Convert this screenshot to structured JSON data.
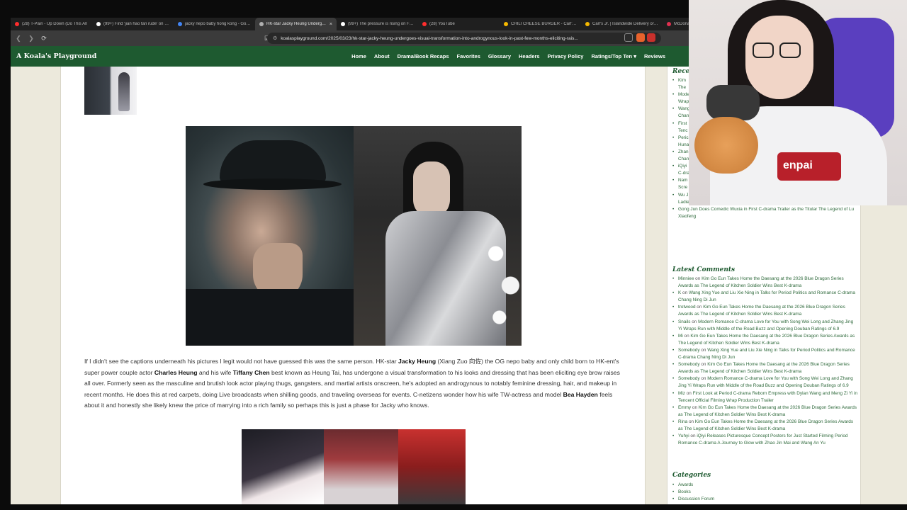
{
  "browser": {
    "tabs": [
      {
        "title": "(28) T-Pain - Up Down (Do This All",
        "color": "#ff2d2d"
      },
      {
        "title": "(99+) Find 'jian hao tan rude' on TikTok",
        "color": "#ffffff"
      },
      {
        "title": "jacky nepo baby hong kong - Google",
        "color": "#4285f4"
      },
      {
        "title": "HK-star Jacky Heung Undergoes",
        "color": "#b0b0b0",
        "active": true
      },
      {
        "title": "(99+) The pressure is rising on FIFA",
        "color": "#ffffff"
      },
      {
        "title": "(28) YouTube",
        "color": "#ff2d2d"
      },
      {
        "title": "CHILI CHEESE BURGER - Carl's Jr.",
        "color": "#f5b800"
      },
      {
        "title": "Carl's Jr. | Islandwide Delivery or Pick",
        "color": "#f5b800"
      },
      {
        "title": "McDona",
        "color": "#e03050"
      }
    ],
    "url": "koalasplayground.com/2025/03/23/hk-star-jacky-heung-undergoes-visual-transformation-into-androgynous-look-in-past-few-months-eliciting-rais..."
  },
  "site": {
    "brand": "A Koala's Playground",
    "nav": [
      "Home",
      "About",
      "Drama/Book Recaps",
      "Favorites",
      "Glossary",
      "Headers",
      "Privacy Policy",
      "Ratings/Top Ten ▾",
      "Reviews"
    ]
  },
  "article": {
    "p1": "If I didn't see the captions underneath his pictures I legit would not have guessed this was the same person. HK-star ",
    "name1": "Jacky Heung",
    "p2": " (Xiang Zuo 向佐) the OG nepo baby and only child born to HK-ent's super power couple actor ",
    "name2": "Charles Heung",
    "p3": " and his wife ",
    "name3": "Tiffany Chen",
    "p4": " best known as Heung Tai, has undergone a visual transformation to his looks and dressing that has been eliciting eye brow raises all over. Formerly seen as the masculine and brutish look actor playing thugs, gangsters, and martial artists onscreen, he's adopted an androgynous to notably feminine dressing, hair, and makeup in recent months. He does this at red carpets, doing Live broadcasts when shilling goods, and traveling overseas for events. C-netizens wonder how his wife TW-actress and model ",
    "name4": "Bea Hayden",
    "p5": " feels about it and honestly she likely knew the price of marrying into a rich family so perhaps this is just a phase for Jacky who knows."
  },
  "sidebar": {
    "recent_heading": "Recent",
    "recent_visible": [
      {
        "title": "Kim",
        "cont": "The"
      },
      {
        "title": "Mode",
        "cont": "Wrap"
      },
      {
        "title": "Wang",
        "cont": "Chan"
      },
      {
        "title": "First",
        "cont": "Tenc"
      },
      {
        "title": "Peric",
        "cont": "Huna"
      },
      {
        "title": "Zhan",
        "cont": "Chan"
      },
      {
        "title": "iQiyi",
        "cont": "C-dra"
      },
      {
        "title": "Nam",
        "cont": "Scre"
      },
      {
        "title": "Wu J",
        "cont": "Ladie"
      }
    ],
    "recent_last": "Gong Jun Does Comedic Wuxia in First C-drama Trailer as the Titular The Legend of Lu Xiaofeng",
    "comments_heading": "Latest Comments",
    "comments": [
      {
        "author": "Minniee",
        "post": "Kim Go Eun Takes Home the Daesang at the 2026 Blue Dragon Series Awards as The Legend of Kitchen Soldier Wins Best K-drama"
      },
      {
        "author": "K",
        "post": "Wang Xing Yue and Liu Xie Ning in Talks for Period Politics and Romance C-drama Chang Ning Di Jun"
      },
      {
        "author": "trotwood",
        "post": "Kim Go Eun Takes Home the Daesang at the 2026 Blue Dragon Series Awards as The Legend of Kitchen Soldier Wins Best K-drama"
      },
      {
        "author": "Snails",
        "post": "Modern Romance C-drama Love for You with Song Wei Long and Zhang Jing Yi Wraps Run with Middle of the Road Buzz and Opening Douban Ratings of 6.9"
      },
      {
        "author": "Mi",
        "post": "Kim Go Eun Takes Home the Daesang at the 2026 Blue Dragon Series Awards as The Legend of Kitchen Soldier Wins Best K-drama"
      },
      {
        "author": "Somebody",
        "post": "Wang Xing Yue and Liu Xie Ning in Talks for Period Politics and Romance C-drama Chang Ning Di Jun"
      },
      {
        "author": "Somebody",
        "post": "Kim Go Eun Takes Home the Daesang at the 2026 Blue Dragon Series Awards as The Legend of Kitchen Soldier Wins Best K-drama"
      },
      {
        "author": "Somebody",
        "post": "Modern Romance C-drama Love for You with Song Wei Long and Zhang Jing Yi Wraps Run with Middle of the Road Buzz and Opening Douban Ratings of 6.9"
      },
      {
        "author": "Miz",
        "post": "First Look at Period C-drama Reborn Empress with Dylan Wang and Meng Zi Yi in Tencent Official Filming Wrap Production Trailer"
      },
      {
        "author": "Emmy",
        "post": "Kim Go Eun Takes Home the Daesang at the 2026 Blue Dragon Series Awards as The Legend of Kitchen Soldier Wins Best K-drama"
      },
      {
        "author": "Rina",
        "post": "Kim Go Eun Takes Home the Daesang at the 2026 Blue Dragon Series Awards as The Legend of Kitchen Soldier Wins Best K-drama"
      },
      {
        "author": "Yuhyi",
        "post": "iQiyi Releases Picturesque Concept Posters for Just Started Filming Period Romance C-drama A Journey to Glow with Zhao Jin Mai and Wang An Yu"
      }
    ],
    "on_word": "on",
    "categories_heading": "Categories",
    "categories": [
      "Awards",
      "Books",
      "Discussion Forum"
    ]
  },
  "webcam": {
    "shirt_text": "enpai"
  }
}
